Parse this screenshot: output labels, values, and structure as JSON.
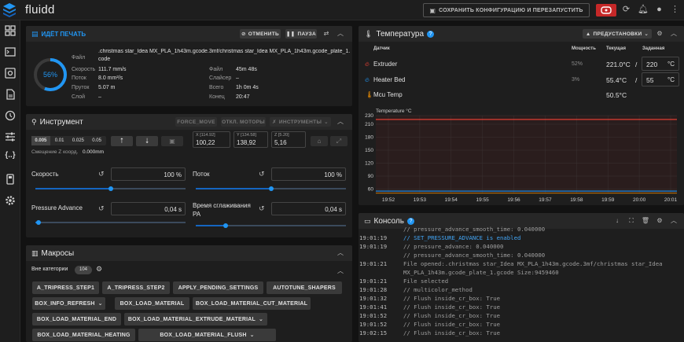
{
  "app": {
    "title": "fluidd"
  },
  "topbar": {
    "save_label": "СОХРАНИТЬ КОНФИГУРАЦИЮ И ПЕРЕЗАПУСТИТЬ"
  },
  "colors": {
    "accent": "#2196f3",
    "estop": "#c62828",
    "extruder": "#f44336",
    "bed": "#2196f3",
    "mcu": "#ff9800"
  },
  "print": {
    "title": "ИДЁТ ПЕЧАТЬ",
    "cancel_label": "ОТМЕНИТЬ",
    "pause_label": "ПАУЗА",
    "progress_percent": 56,
    "progress_label": "56%",
    "file_label": "Файл",
    "file_name": ".christmas star_Idea MX_PLA_1h43m.gcode.3mf/christmas star_Idea MX_PLA_1h43m.gcode_plate_1.g",
    "file_name_cont": "code",
    "left": [
      {
        "label": "Скорость",
        "value": "111.7 mm/s"
      },
      {
        "label": "Поток",
        "value": "8.0 mm²/s"
      },
      {
        "label": "Пруток",
        "value": "5.07 m"
      },
      {
        "label": "Слой",
        "value": "–"
      }
    ],
    "right": [
      {
        "label": "Файл",
        "value": "45m 48s"
      },
      {
        "label": "Слайсер",
        "value": "–"
      },
      {
        "label": "Всего",
        "value": "1h 0m 4s"
      },
      {
        "label": "Конец",
        "value": "20:47"
      }
    ]
  },
  "tool": {
    "title": "Инструмент",
    "force_move": "FORCE_MOVE",
    "motors_off": "ОТКЛ. МОТОРЫ",
    "tools_label": "ИНСТРУМЕНТЫ",
    "steps": [
      "0.005",
      "0.01",
      "0.025",
      "0.05"
    ],
    "z_offset_label": "Смещение Z коорд.",
    "z_offset_value": "0.000mm",
    "x": {
      "label": "X [114.92]",
      "value": "100,22"
    },
    "y": {
      "label": "Y [134.58]",
      "value": "138,92"
    },
    "z": {
      "label": "Z [5.20]",
      "value": "5,16"
    },
    "speed": {
      "label": "Скорость",
      "value": "100 %",
      "fraction": 0.5
    },
    "flow": {
      "label": "Поток",
      "value": "100 %",
      "fraction": 0.5
    },
    "pa": {
      "label": "Pressure Advance",
      "value": "0,04 s",
      "fraction": 0.02
    },
    "smooth": {
      "label_1": "Время сглаживания",
      "label_2": "PA",
      "value": "0,04 s",
      "fraction": 0.2
    }
  },
  "macros": {
    "title": "Макросы",
    "category_label": "Вне категории",
    "count": "104",
    "buttons": [
      "A_TRIPRESS_STEP1",
      "A_TRIPRESS_STEP2",
      "APPLY_PENDING_SETTINGS",
      "AUTOTUNE_SHAPERS",
      "BOX_INFO_REFRESH",
      "BOX_LOAD_MATERIAL",
      "BOX_LOAD_MATERIAL_CUT_MATERIAL",
      "BOX_LOAD_MATERIAL_END",
      "BOX_LOAD_MATERIAL_EXTRUDE_MATERIAL",
      "BOX_LOAD_MATERIAL_HEATING",
      "BOX_LOAD_MATERIAL_FLUSH"
    ]
  },
  "temps": {
    "title": "Температура",
    "presets_label": "ПРЕДУСТАНОВКИ",
    "headers": {
      "sensor": "Датчик",
      "power": "Мощность",
      "current": "Текущая",
      "target": "Заданная"
    },
    "rows": [
      {
        "name": "Extruder",
        "power": "52%",
        "current": "221.0°C",
        "slash": "/",
        "target": "220",
        "unit": "°C"
      },
      {
        "name": "Heater Bed",
        "power": "3%",
        "current": "55.4°C",
        "slash": "/",
        "target": "55",
        "unit": "°C"
      },
      {
        "name": "Mcu Temp",
        "power": "",
        "current": "50.5°C"
      }
    ]
  },
  "chart_data": {
    "type": "line",
    "title": "",
    "ylabel": "Temperature °C",
    "xlabel": "",
    "ylim": [
      50,
      230
    ],
    "yticks": [
      60,
      90,
      120,
      150,
      180,
      210,
      230
    ],
    "xticks": [
      "19:52",
      "19:53",
      "19:54",
      "19:55",
      "19:56",
      "19:57",
      "19:58",
      "19:59",
      "20:00",
      "20:01"
    ],
    "grid": true,
    "series": [
      {
        "values": [
          221,
          221,
          221,
          221,
          221,
          221,
          221,
          221,
          221,
          221
        ]
      },
      {
        "values": [
          55.4,
          55.4,
          55.4,
          55.4,
          55.4,
          55.4,
          55.4,
          55.4,
          55.4,
          55.4
        ]
      },
      {
        "values": [
          50.5,
          50.5,
          50.5,
          50.5,
          50.5,
          50.5,
          50.5,
          50.5,
          50.5,
          50.5
        ]
      }
    ]
  },
  "console": {
    "title": "Консоль",
    "lines": [
      {
        "ts": "",
        "msg": "// pressure_advance_smooth_time: 0.040000",
        "blue": false
      },
      {
        "ts": "19:01:19",
        "msg": "// SET_PRESSURE_ADVANCE is enabled",
        "blue": true
      },
      {
        "ts": "19:01:19",
        "msg": "// pressure_advance: 0.040000",
        "blue": false
      },
      {
        "ts": "",
        "msg": "// pressure_advance_smooth_time: 0.040000",
        "blue": false
      },
      {
        "ts": "19:01:21",
        "msg": "File opened:.christmas star_Idea MX_PLA_1h43m.gcode.3mf/christmas star_Idea",
        "blue": false
      },
      {
        "ts": "",
        "msg": "MX_PLA_1h43m.gcode_plate_1.gcode Size:9459460",
        "blue": false
      },
      {
        "ts": "19:01:21",
        "msg": "File selected",
        "blue": false
      },
      {
        "ts": "19:01:28",
        "msg": "// multicolor_method",
        "blue": false
      },
      {
        "ts": "19:01:32",
        "msg": "// Flush inside_cr_box: True",
        "blue": false
      },
      {
        "ts": "19:01:41",
        "msg": "// Flush inside_cr_box: True",
        "blue": false
      },
      {
        "ts": "19:01:52",
        "msg": "// Flush inside_cr_box: True",
        "blue": false
      },
      {
        "ts": "19:01:52",
        "msg": "// Flush inside_cr_box: True",
        "blue": false
      },
      {
        "ts": "19:02:15",
        "msg": "// Flush inside_cr_box: True",
        "blue": false
      }
    ]
  }
}
